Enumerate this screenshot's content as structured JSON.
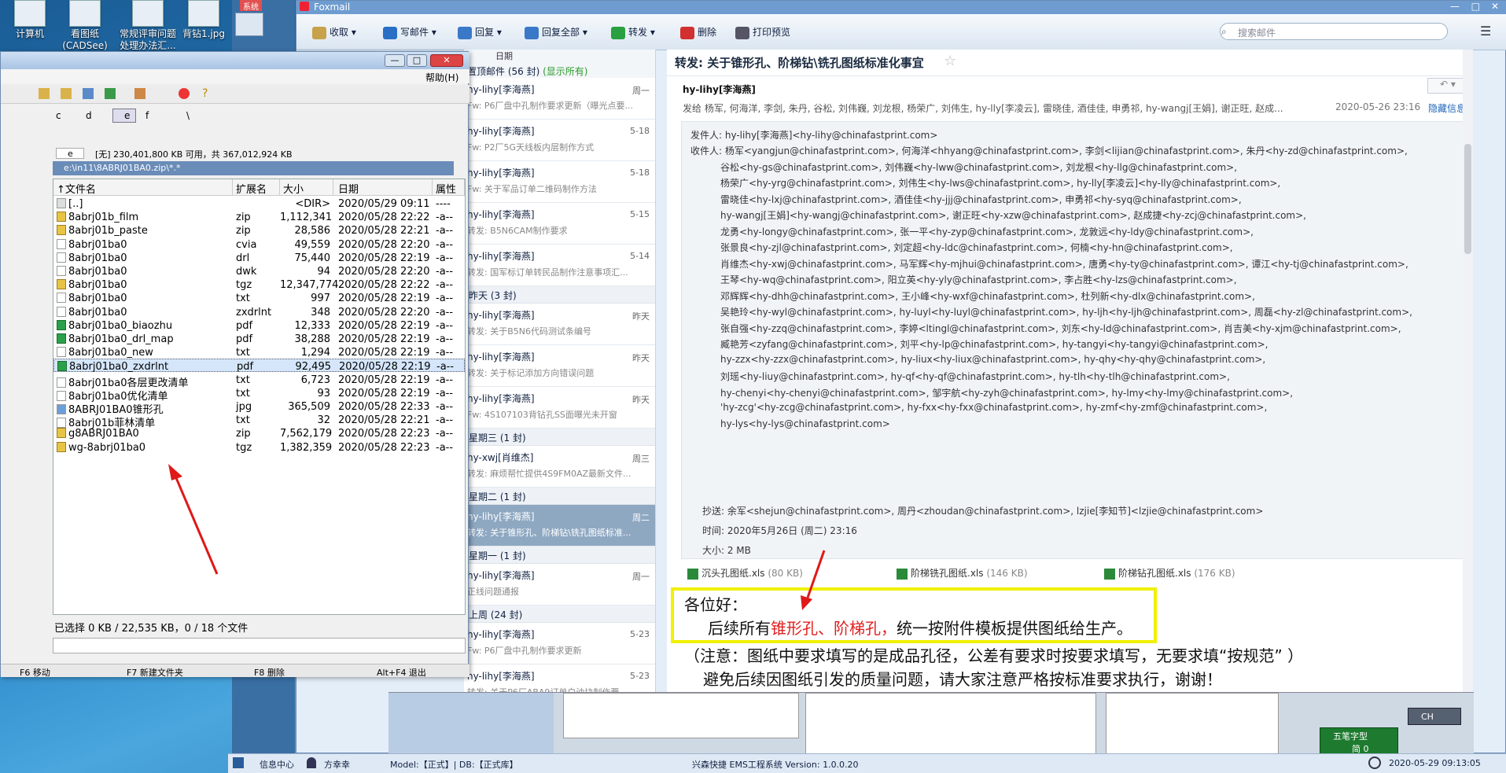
{
  "desktop": {
    "icons": [
      "计算机",
      "看图纸\n(CADSee)",
      "常规评审问题\n处理办法汇...",
      "背钻1.jpg"
    ],
    "side_tab": "系统"
  },
  "foxmail": {
    "title": "Foxmail",
    "toolbar": [
      "收取",
      "写邮件",
      "回复",
      "回复全部",
      "转发",
      "删除",
      "打印预览"
    ],
    "search_placeholder": "搜索邮件",
    "list": {
      "sort_label": "日期",
      "pinned_label": "置顶邮件 (56 封)",
      "show_all": "(显示所有)",
      "groups": [
        {
          "label": null,
          "items": [
            {
              "from": "hy-lihy[李海燕]",
              "date": "周一",
              "subject": "Fw: P6厂盘中孔制作要求更新（曝光点要..."
            },
            {
              "from": "hy-lihy[李海燕]",
              "date": "5-18",
              "subject": "Fw: P2厂5G天线板内层制作方式"
            },
            {
              "from": "hy-lihy[李海燕]",
              "date": "5-18",
              "subject": "Fw: 关于军品订单二维码制作方法"
            },
            {
              "from": "hy-lihy[李海燕]",
              "date": "5-15",
              "subject": "转发: B5N6CAM制作要求"
            },
            {
              "from": "hy-lihy[李海燕]",
              "date": "5-14",
              "subject": "转发: 国军标订单转民品制作注意事项汇..."
            }
          ]
        },
        {
          "label": "昨天 (3 封)",
          "items": [
            {
              "from": "hy-lihy[李海燕]",
              "date": "昨天",
              "subject": "转发: 关于B5N6代码测试条编号"
            },
            {
              "from": "hy-lihy[李海燕]",
              "date": "昨天",
              "subject": "转发: 关于标记添加方向错误问题"
            },
            {
              "from": "hy-lihy[李海燕]",
              "date": "昨天",
              "subject": "Fw: 4S107103背钻孔SS面曝光未开窗"
            }
          ]
        },
        {
          "label": "星期三 (1 封)",
          "items": [
            {
              "from": "hy-xwj[肖维杰]",
              "date": "周三",
              "subject": "转发: 麻烦帮忙提供4S9FM0AZ最新文件..."
            }
          ]
        },
        {
          "label": "星期二 (1 封)",
          "items": [
            {
              "from": "hy-lihy[李海燕]",
              "date": "周二",
              "subject": "转发: 关于锥形孔、阶梯钻\\铣孔图纸标准...",
              "selected": true
            }
          ]
        },
        {
          "label": "星期一 (1 封)",
          "items": [
            {
              "from": "hy-lihy[李海燕]",
              "date": "周一",
              "subject": "正线问题通报"
            }
          ]
        },
        {
          "label": "上周 (24 封)",
          "items": [
            {
              "from": "hy-lihy[李海燕]",
              "date": "5-23",
              "subject": "Fw: P6厂盘中孔制作要求更新"
            },
            {
              "from": "hy-lihy[李海燕]",
              "date": "5-23",
              "subject": "转发: 关于P6厂ABA9订单白油块制作要..."
            }
          ]
        }
      ]
    },
    "mail": {
      "subject": "转发: 关于锥形孔、阶梯钻\\铣孔图纸标准化事宜",
      "sender_short": "hy-lihy[李海燕]",
      "recipients_short": "发给 杨军, 何海洋, 李剑, 朱丹, 谷松, 刘伟巍, 刘龙根, 杨荣广, 刘伟生, hy-lly[李凌云], 雷晓佳, 酒佳佳, 申勇祁, hy-wangj[王娟], 谢正旺, 赵成...",
      "datetime": "2020-05-26 23:16",
      "hide_info": "隐藏信息",
      "from_line": "发件人: hy-lihy[李海燕]<hy-lihy@chinafastprint.com>",
      "to_lines": [
        "收件人: 杨军<yangjun@chinafastprint.com>,  何海洋<hhyang@chinafastprint.com>,  李剑<lijian@chinafastprint.com>,  朱丹<hy-zd@chinafastprint.com>,",
        "谷松<hy-gs@chinafastprint.com>,  刘伟巍<hy-lww@chinafastprint.com>,  刘龙根<hy-llg@chinafastprint.com>,",
        "杨荣广<hy-yrg@chinafastprint.com>,  刘伟生<hy-lws@chinafastprint.com>,  hy-lly[李凌云]<hy-lly@chinafastprint.com>,",
        "雷晓佳<hy-lxj@chinafastprint.com>,  酒佳佳<hy-jjj@chinafastprint.com>,  申勇祁<hy-syq@chinafastprint.com>,",
        "hy-wangj[王娟]<hy-wangj@chinafastprint.com>,  谢正旺<hy-xzw@chinafastprint.com>,  赵成捷<hy-zcj@chinafastprint.com>,",
        "龙勇<hy-longy@chinafastprint.com>,  张一平<hy-zyp@chinafastprint.com>,  龙敦远<hy-ldy@chinafastprint.com>,",
        "张景良<hy-zjl@chinafastprint.com>,  刘定超<hy-ldc@chinafastprint.com>,  何楠<hy-hn@chinafastprint.com>,",
        "肖维杰<hy-xwj@chinafastprint.com>,  马军辉<hy-mjhui@chinafastprint.com>,  唐勇<hy-ty@chinafastprint.com>,  谭江<hy-tj@chinafastprint.com>,",
        "王琴<hy-wq@chinafastprint.com>,  阳立英<hy-yly@chinafastprint.com>,  李占胜<hy-lzs@chinafastprint.com>,",
        "邓辉辉<hy-dhh@chinafastprint.com>,  王小峰<hy-wxf@chinafastprint.com>,  杜列新<hy-dlx@chinafastprint.com>,",
        "吴艳玲<hy-wyl@chinafastprint.com>,  hy-luyl<hy-luyl@chinafastprint.com>,  hy-ljh<hy-ljh@chinafastprint.com>,  周磊<hy-zl@chinafastprint.com>,",
        "张自强<hy-zzq@chinafastprint.com>,  李婷<ltingl@chinafastprint.com>,  刘东<hy-ld@chinafastprint.com>,  肖吉美<hy-xjm@chinafastprint.com>,",
        "臧艳芳<zyfang@chinafastprint.com>,  刘平<hy-lp@chinafastprint.com>,  hy-tangyi<hy-tangyi@chinafastprint.com>,",
        "hy-zzx<hy-zzx@chinafastprint.com>,  hy-liux<hy-liux@chinafastprint.com>,  hy-qhy<hy-qhy@chinafastprint.com>,",
        "刘瑶<hy-liuy@chinafastprint.com>,  hy-qf<hy-qf@chinafastprint.com>,  hy-tlh<hy-tlh@chinafastprint.com>,",
        "hy-chenyi<hy-chenyi@chinafastprint.com>,  邹宇航<hy-zyh@chinafastprint.com>,  hy-lmy<hy-lmy@chinafastprint.com>,",
        "'hy-zcg'<hy-zcg@chinafastprint.com>,  hy-fxx<hy-fxx@chinafastprint.com>,  hy-zmf<hy-zmf@chinafastprint.com>,",
        "hy-lys<hy-lys@chinafastprint.com>"
      ],
      "cc_line": "抄送: 余军<shejun@chinafastprint.com>,  周丹<zhoudan@chinafastprint.com>,  lzjie[李知节]<lzjie@chinafastprint.com>",
      "time_line": "时间: 2020年5月26日 (周二) 23:16",
      "size_line": "大小: 2 MB",
      "attachments": [
        {
          "name": "沉头孔图纸.xls",
          "size": "(80 KB)"
        },
        {
          "name": "阶梯铣孔图纸.xls",
          "size": "(146 KB)"
        },
        {
          "name": "阶梯钻孔图纸.xls",
          "size": "(176 KB)"
        }
      ],
      "body_greeting": "各位好：",
      "body_l2_a": "后续所有",
      "body_l2_red": "锥形孔、阶梯孔，",
      "body_l2_b": "统一按附件模板提供图纸给生产。",
      "body_l3": "（注意：图纸中要求填写的是成品孔径，公差有要求时按要求填写，无要求填“按规范”  ）",
      "body_l4": "避免后续因图纸引发的质量问题，请大家注意严格按标准要求执行，谢谢！"
    }
  },
  "filemanager": {
    "help": "帮助(H)",
    "drive_info": "[无]  230,401,800 KB 可用，共 367,012,924 KB",
    "drive_sel": "e",
    "drives": [
      "c",
      "d",
      "e",
      "f",
      "\\"
    ],
    "path": "e:\\in11\\8ABRJ01BA0.zip\\*.*",
    "columns": [
      "文件名",
      "扩展名",
      "大小",
      "日期",
      "属性"
    ],
    "files": [
      {
        "name": "[..]",
        "ext": "",
        "size": "<DIR>",
        "date": "2020/05/29 09:11",
        "attr": "----",
        "icon": "up"
      },
      {
        "name": "8abrj01b_film",
        "ext": "zip",
        "size": "1,112,341",
        "date": "2020/05/28 22:22",
        "attr": "-a--",
        "icon": "zip"
      },
      {
        "name": "8abrj01b_paste",
        "ext": "zip",
        "size": "28,586",
        "date": "2020/05/28 22:21",
        "attr": "-a--",
        "icon": "zip"
      },
      {
        "name": "8abrj01ba0",
        "ext": "cvia",
        "size": "49,559",
        "date": "2020/05/28 22:20",
        "attr": "-a--",
        "icon": "file"
      },
      {
        "name": "8abrj01ba0",
        "ext": "drl",
        "size": "75,440",
        "date": "2020/05/28 22:19",
        "attr": "-a--",
        "icon": "file"
      },
      {
        "name": "8abrj01ba0",
        "ext": "dwk",
        "size": "94",
        "date": "2020/05/28 22:20",
        "attr": "-a--",
        "icon": "file"
      },
      {
        "name": "8abrj01ba0",
        "ext": "tgz",
        "size": "12,347,774",
        "date": "2020/05/28 22:22",
        "attr": "-a--",
        "icon": "zip"
      },
      {
        "name": "8abrj01ba0",
        "ext": "txt",
        "size": "997",
        "date": "2020/05/28 22:19",
        "attr": "-a--",
        "icon": "file"
      },
      {
        "name": "8abrj01ba0",
        "ext": "zxdrlnt",
        "size": "348",
        "date": "2020/05/28 22:20",
        "attr": "-a--",
        "icon": "file"
      },
      {
        "name": "8abrj01ba0_biaozhu",
        "ext": "pdf",
        "size": "12,333",
        "date": "2020/05/28 22:19",
        "attr": "-a--",
        "icon": "pdf"
      },
      {
        "name": "8abrj01ba0_drl_map",
        "ext": "pdf",
        "size": "38,288",
        "date": "2020/05/28 22:19",
        "attr": "-a--",
        "icon": "pdf"
      },
      {
        "name": "8abrj01ba0_new",
        "ext": "txt",
        "size": "1,294",
        "date": "2020/05/28 22:19",
        "attr": "-a--",
        "icon": "file"
      },
      {
        "name": "8abrj01ba0_zxdrlnt",
        "ext": "pdf",
        "size": "92,495",
        "date": "2020/05/28 22:19",
        "attr": "-a--",
        "icon": "pdf",
        "selected": true
      },
      {
        "name": "8abrj01ba0各层更改清单",
        "ext": "txt",
        "size": "6,723",
        "date": "2020/05/28 22:19",
        "attr": "-a--",
        "icon": "file"
      },
      {
        "name": "8abrj01ba0优化清单",
        "ext": "txt",
        "size": "93",
        "date": "2020/05/28 22:19",
        "attr": "-a--",
        "icon": "file"
      },
      {
        "name": "8ABRJ01BA0锥形孔",
        "ext": "jpg",
        "size": "365,509",
        "date": "2020/05/28 22:33",
        "attr": "-a--",
        "icon": "jpg"
      },
      {
        "name": "8abrj01b菲林清单",
        "ext": "txt",
        "size": "32",
        "date": "2020/05/28 22:21",
        "attr": "-a--",
        "icon": "file"
      },
      {
        "name": "g8ABRJ01BA0",
        "ext": "zip",
        "size": "7,562,179",
        "date": "2020/05/28 22:23",
        "attr": "-a--",
        "icon": "zip"
      },
      {
        "name": "wg-8abrj01ba0",
        "ext": "tgz",
        "size": "1,382,359",
        "date": "2020/05/28 22:23",
        "attr": "-a--",
        "icon": "zip"
      }
    ],
    "status": "已选择 0 KB / 22,535 KB，0 / 18 个文件",
    "fkeys": [
      "F6 移动",
      "F7 新建文件夹",
      "F8 删除",
      "Alt+F4 退出"
    ]
  },
  "taskbar": {
    "info_center": "信息中心",
    "user": "方幸幸",
    "model": "Model:【正式】| DB:【正式库】",
    "system": "兴森快捷 EMS工程系统 Version: 1.0.0.20",
    "clock": "2020-05-29 09:13:05",
    "ime": "五笔字型",
    "ime2": "简 0",
    "lang": "CH"
  }
}
